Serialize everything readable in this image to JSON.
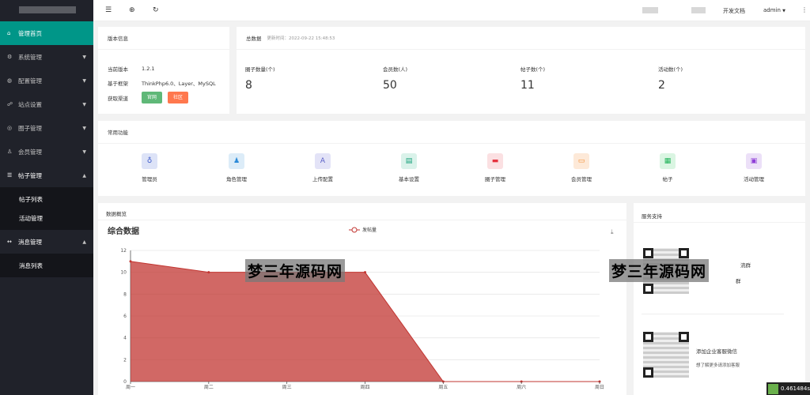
{
  "sidebar": {
    "menu": [
      {
        "label": "管理首页",
        "icon": "home-icon"
      },
      {
        "label": "系统管理",
        "icon": "settings-icon"
      },
      {
        "label": "配置管理",
        "icon": "config-icon"
      },
      {
        "label": "站点设置",
        "icon": "site-icon"
      },
      {
        "label": "圈子管理",
        "icon": "circle-icon"
      },
      {
        "label": "会员管理",
        "icon": "user-icon"
      },
      {
        "label": "帖子管理",
        "icon": "post-icon"
      },
      {
        "label": "消息管理",
        "icon": "message-icon"
      }
    ],
    "post_sub": [
      "帖子列表",
      "活动管理"
    ],
    "msg_sub": [
      "消息列表"
    ]
  },
  "topbar": {
    "docs": "开发文档",
    "user": "admin"
  },
  "version": {
    "title": "版本信息",
    "rows": [
      {
        "k": "当前版本",
        "v": "1.2.1"
      },
      {
        "k": "基于框架",
        "v": "ThinkPhp6.0、Layer、MySQL"
      },
      {
        "k": "获取渠道",
        "v": ""
      }
    ],
    "btn_official": "官网",
    "btn_community": "社区"
  },
  "summary": {
    "title": "总数据",
    "updated": "更新时间：2022-09-22 15:48:53",
    "stats": [
      {
        "label": "圈子数量(个)",
        "value": "8"
      },
      {
        "label": "会员数(人)",
        "value": "50"
      },
      {
        "label": "帖子数(个)",
        "value": "11"
      },
      {
        "label": "活动数(个)",
        "value": "2"
      }
    ]
  },
  "functions": {
    "title": "常用功能",
    "items": [
      "管理员",
      "角色管理",
      "上传配置",
      "基本设置",
      "圈子管理",
      "会员管理",
      "帖子",
      "活动管理"
    ]
  },
  "overview": {
    "title": "数据概览"
  },
  "service": {
    "title": "服务支持",
    "text1": "添加企业客服微信",
    "text2": "想了解更多请添加客服",
    "frag1": "流群",
    "frag2": "群"
  },
  "watermark": "梦三年源码网",
  "perf": "0.461484s",
  "chart_data": {
    "type": "area",
    "title": "综合数据",
    "categories": [
      "周一",
      "周二",
      "周三",
      "周四",
      "周五",
      "周六",
      "周日"
    ],
    "series": [
      {
        "name": "发帖量",
        "values": [
          11,
          10,
          10,
          10,
          0,
          0,
          0
        ]
      }
    ],
    "ylim": [
      0,
      12
    ],
    "yticks": [
      0,
      2,
      4,
      6,
      8,
      10,
      12
    ],
    "color": "#c23531"
  }
}
